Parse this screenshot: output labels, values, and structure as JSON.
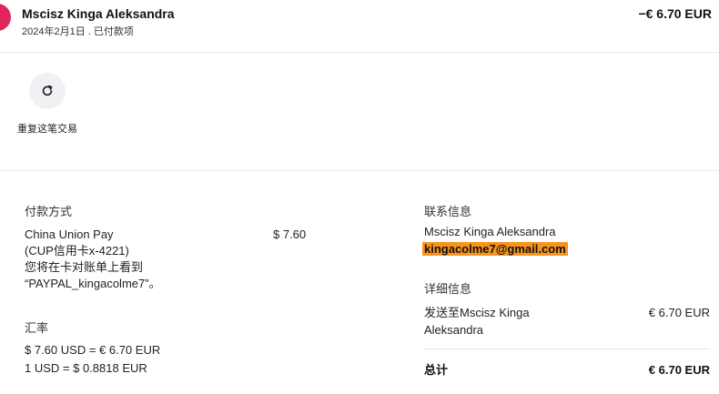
{
  "header": {
    "merchant_name": "Mscisz Kinga Aleksandra",
    "subtitle": "2024年2月1日 . 已付款项",
    "amount": "−€ 6.70 EUR"
  },
  "actions": {
    "repeat_label": "重复这笔交易",
    "repeat_icon": "refresh-icon",
    "accent_color": "#1a1a2e"
  },
  "payment": {
    "title": "付款方式",
    "method_lines": [
      "China Union Pay",
      "(CUP信用卡x-4221)",
      "您将在卡对账单上看到",
      "“PAYPAL_kingacolme7”。"
    ],
    "amount": "$ 7.60"
  },
  "exchange": {
    "title": "汇率",
    "line1": "$ 7.60 USD = € 6.70 EUR",
    "line2": "1 USD = $ 0.8818 EUR"
  },
  "contact": {
    "title": "联系信息",
    "name": "Mscisz Kinga Aleksandra",
    "email": "kingacolme7@gmail.com",
    "highlight_color": "#f7941d"
  },
  "details": {
    "title": "详细信息",
    "sent_to_line1": "发送至Mscisz Kinga",
    "sent_to_line2": "Aleksandra",
    "sent_amount": "€ 6.70 EUR",
    "total_label": "总计",
    "total_amount": "€ 6.70 EUR"
  }
}
